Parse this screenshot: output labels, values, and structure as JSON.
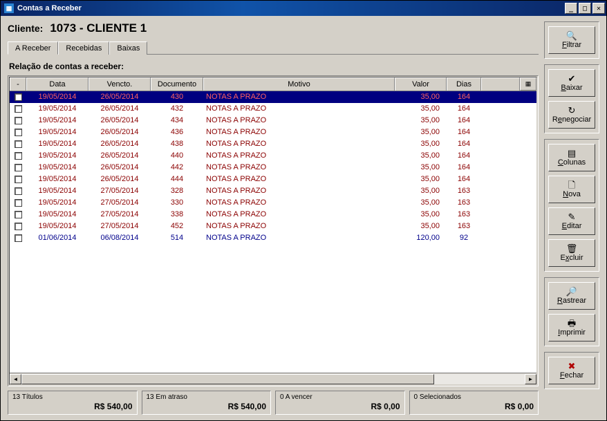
{
  "window": {
    "title": "Contas a Receber"
  },
  "cliente": {
    "label": "Cliente:",
    "value": "1073 - CLIENTE 1"
  },
  "tabs": [
    "A Receber",
    "Recebidas",
    "Baixas"
  ],
  "subtitle": "Relação de contas a receber:",
  "columns": {
    "chk": "-",
    "data": "Data",
    "vencto": "Vencto.",
    "documento": "Documento",
    "motivo": "Motivo",
    "valor": "Valor",
    "dias": "Dias"
  },
  "rows": [
    {
      "data": "19/05/2014",
      "vencto": "26/05/2014",
      "doc": "430",
      "motivo": "NOTAS A PRAZO",
      "valor": "35,00",
      "dias": "164",
      "sel": true
    },
    {
      "data": "19/05/2014",
      "vencto": "26/05/2014",
      "doc": "432",
      "motivo": "NOTAS A PRAZO",
      "valor": "35,00",
      "dias": "164"
    },
    {
      "data": "19/05/2014",
      "vencto": "26/05/2014",
      "doc": "434",
      "motivo": "NOTAS A PRAZO",
      "valor": "35,00",
      "dias": "164"
    },
    {
      "data": "19/05/2014",
      "vencto": "26/05/2014",
      "doc": "436",
      "motivo": "NOTAS A PRAZO",
      "valor": "35,00",
      "dias": "164"
    },
    {
      "data": "19/05/2014",
      "vencto": "26/05/2014",
      "doc": "438",
      "motivo": "NOTAS A PRAZO",
      "valor": "35,00",
      "dias": "164"
    },
    {
      "data": "19/05/2014",
      "vencto": "26/05/2014",
      "doc": "440",
      "motivo": "NOTAS A PRAZO",
      "valor": "35,00",
      "dias": "164"
    },
    {
      "data": "19/05/2014",
      "vencto": "26/05/2014",
      "doc": "442",
      "motivo": "NOTAS A PRAZO",
      "valor": "35,00",
      "dias": "164"
    },
    {
      "data": "19/05/2014",
      "vencto": "26/05/2014",
      "doc": "444",
      "motivo": "NOTAS A PRAZO",
      "valor": "35,00",
      "dias": "164"
    },
    {
      "data": "19/05/2014",
      "vencto": "27/05/2014",
      "doc": "328",
      "motivo": "NOTAS A PRAZO",
      "valor": "35,00",
      "dias": "163"
    },
    {
      "data": "19/05/2014",
      "vencto": "27/05/2014",
      "doc": "330",
      "motivo": "NOTAS A PRAZO",
      "valor": "35,00",
      "dias": "163"
    },
    {
      "data": "19/05/2014",
      "vencto": "27/05/2014",
      "doc": "338",
      "motivo": "NOTAS A PRAZO",
      "valor": "35,00",
      "dias": "163"
    },
    {
      "data": "19/05/2014",
      "vencto": "27/05/2014",
      "doc": "452",
      "motivo": "NOTAS A PRAZO",
      "valor": "35,00",
      "dias": "163"
    },
    {
      "data": "01/06/2014",
      "vencto": "06/08/2014",
      "doc": "514",
      "motivo": "NOTAS A PRAZO",
      "valor": "120,00",
      "dias": "92",
      "blue": true
    }
  ],
  "summary": {
    "titulos": {
      "label": "13 Títulos",
      "value": "R$ 540,00"
    },
    "atraso": {
      "label": "13 Em atraso",
      "value": "R$ 540,00"
    },
    "vencer": {
      "label": "0 A vencer",
      "value": "R$ 0,00"
    },
    "selec": {
      "label": "0 Selecionados",
      "value": "R$ 0,00"
    }
  },
  "sidebar": {
    "filtrar": "Filtrar",
    "baixar": "Baixar",
    "renegociar": "Renegociar",
    "colunas": "Colunas",
    "nova": "Nova",
    "editar": "Editar",
    "excluir": "Excluir",
    "rastrear": "Rastrear",
    "imprimir": "Imprimir",
    "fechar": "Fechar"
  },
  "icons": {
    "filtrar": "🔍",
    "baixar": "✔",
    "renegociar": "↻",
    "colunas": "▤",
    "nova": "🗋",
    "editar": "✎",
    "excluir": "🗑",
    "rastrear": "🔎",
    "imprimir": "🖶",
    "fechar": "✖"
  }
}
